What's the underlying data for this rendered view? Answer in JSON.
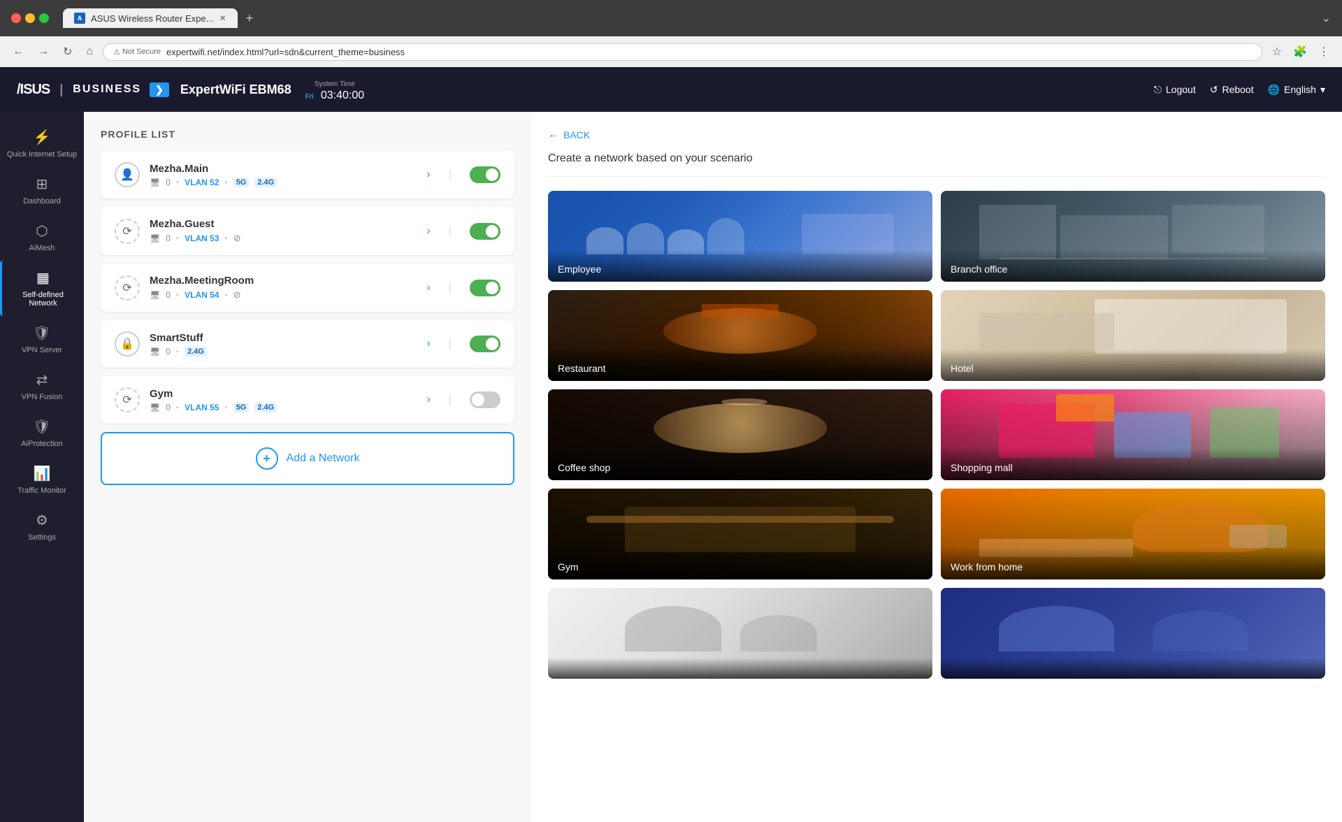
{
  "browser": {
    "tab_title": "ASUS Wireless Router Expe...",
    "new_tab_label": "+",
    "url": "expertwifi.net/index.html?url=sdn&current_theme=business",
    "security": "Not Secure",
    "back_disabled": false,
    "forward_disabled": false
  },
  "header": {
    "brand": "ASUS",
    "separator": "|",
    "product_line": "BUSINESS",
    "arrow": "❯",
    "router_name": "ExpertWiFi EBM68",
    "system_time_label": "System Time",
    "system_time_day": "Fri",
    "system_time_value": "03:40:00",
    "logout_label": "Logout",
    "reboot_label": "Reboot",
    "language_label": "English"
  },
  "sidebar": {
    "items": [
      {
        "id": "quick-internet",
        "label": "Quick Internet Setup",
        "icon": "⚡"
      },
      {
        "id": "dashboard",
        "label": "Dashboard",
        "icon": "⊞"
      },
      {
        "id": "aimesh",
        "label": "AiMesh",
        "icon": "⬡"
      },
      {
        "id": "self-defined-network",
        "label": "Self-defined Network",
        "icon": "🔲",
        "active": true
      },
      {
        "id": "vpn-server",
        "label": "VPN Server",
        "icon": "🛡"
      },
      {
        "id": "vpn-fusion",
        "label": "VPN Fusion",
        "icon": "🔀"
      },
      {
        "id": "aiprotection",
        "label": "AiProtection",
        "icon": "🛡"
      },
      {
        "id": "traffic-monitor",
        "label": "Traffic Monitor",
        "icon": "📊"
      },
      {
        "id": "settings",
        "label": "Settings",
        "icon": "⚙"
      }
    ]
  },
  "profile_list": {
    "title": "PROFILE LIST",
    "networks": [
      {
        "id": "mezha-main",
        "name": "Mezha.Main",
        "icon": "👤",
        "devices": "0",
        "vlan": "52",
        "bands": [
          "5G",
          "2.4G"
        ],
        "enabled": true
      },
      {
        "id": "mezha-guest",
        "name": "Mezha.Guest",
        "icon": "🔁",
        "devices": "0",
        "vlan": "53",
        "bands": [],
        "no_wifi": true,
        "enabled": true
      },
      {
        "id": "mezha-meeting",
        "name": "Mezha.MeetingRoom",
        "icon": "🔁",
        "devices": "0",
        "vlan": "54",
        "bands": [],
        "no_wifi": true,
        "enabled": true
      },
      {
        "id": "smartstuff",
        "name": "SmartStuff",
        "icon": "🔒",
        "devices": "0",
        "bands": [
          "2.4G"
        ],
        "enabled": true
      },
      {
        "id": "gym",
        "name": "Gym",
        "icon": "🔁",
        "devices": "0",
        "vlan": "55",
        "bands": [
          "5G",
          "2.4G"
        ],
        "enabled": false
      }
    ],
    "add_network_label": "Add a Network"
  },
  "scenario_panel": {
    "back_label": "BACK",
    "title": "Create a network based on your scenario",
    "scenarios": [
      {
        "id": "employee",
        "label": "Employee",
        "img_class": "img-employee"
      },
      {
        "id": "branch-office",
        "label": "Branch office",
        "img_class": "img-branch"
      },
      {
        "id": "restaurant",
        "label": "Restaurant",
        "img_class": "img-restaurant"
      },
      {
        "id": "hotel",
        "label": "Hotel",
        "img_class": "img-hotel"
      },
      {
        "id": "coffee-shop",
        "label": "Coffee shop",
        "img_class": "img-coffee"
      },
      {
        "id": "shopping-mall",
        "label": "Shopping mall",
        "img_class": "img-shopping"
      },
      {
        "id": "gym",
        "label": "Gym",
        "img_class": "img-gym"
      },
      {
        "id": "work-from-home",
        "label": "Work from home",
        "img_class": "img-wfh"
      },
      {
        "id": "extra1",
        "label": "",
        "img_class": "img-extra1"
      },
      {
        "id": "extra2",
        "label": "",
        "img_class": "img-extra2"
      }
    ]
  }
}
